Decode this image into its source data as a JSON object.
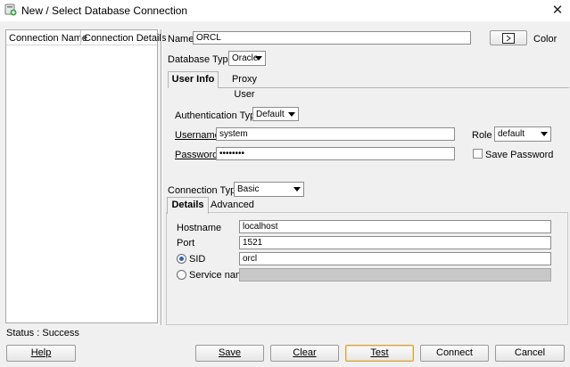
{
  "window": {
    "title": "New / Select Database Connection",
    "close_glyph": "✕"
  },
  "connections_list": {
    "columns": [
      "Connection Name",
      "Connection Details"
    ]
  },
  "form": {
    "name_label": "Name",
    "name_value": "ORCL",
    "color_label": "Color",
    "database_type_label": "Database Type",
    "database_type_value": "Oracle",
    "tabs": [
      {
        "label": "User Info",
        "selected": true
      },
      {
        "label": "Proxy User",
        "selected": false
      }
    ],
    "authentication_type_label": "Authentication Type",
    "authentication_type_value": "Default",
    "username_label": "Username",
    "username_value": "system",
    "password_label": "Password",
    "password_value": "••••••••",
    "role_label": "Role",
    "role_value": "default",
    "save_password_label": "Save Password",
    "connection_type_label": "Connection Type",
    "connection_type_value": "Basic",
    "detail_tabs": [
      {
        "label": "Details",
        "selected": true
      },
      {
        "label": "Advanced",
        "selected": false
      }
    ],
    "hostname_label": "Hostname",
    "hostname_value": "localhost",
    "port_label": "Port",
    "port_value": "1521",
    "sid_label": "SID",
    "sid_value": "orcl",
    "service_name_label": "Service name",
    "service_name_value": ""
  },
  "status": {
    "text": "Status : Success"
  },
  "buttons": {
    "help": "Help",
    "save": "Save",
    "clear": "Clear",
    "test": "Test",
    "connect": "Connect",
    "cancel": "Cancel"
  },
  "icons": {
    "app_icon": "database-new-icon",
    "color_picker_icon": "color-swatch-icon"
  }
}
